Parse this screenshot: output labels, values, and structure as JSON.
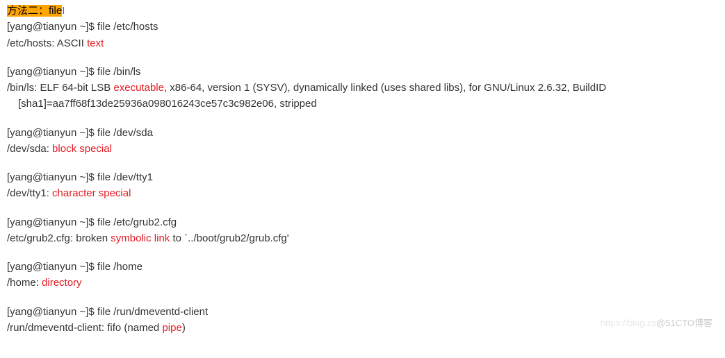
{
  "header": {
    "highlight": "方法二：file",
    "cursor": "I"
  },
  "blocks": [
    {
      "cmd_prefix": "[yang@tianyun ~]$ ",
      "cmd": "file /etc/hosts",
      "out_before": "/etc/hosts: ASCII ",
      "out_red": "text",
      "out_after": ""
    },
    {
      "cmd_prefix": "[yang@tianyun ~]$ ",
      "cmd": "file /bin/ls",
      "out_before": "/bin/ls: ELF 64-bit LSB ",
      "out_red": "executable",
      "out_after": ", x86-64, version 1 (SYSV), dynamically linked (uses shared libs), for GNU/Linux 2.6.32, BuildID",
      "out_line2": "[sha1]=aa7ff68f13de25936a098016243ce57c3c982e06, stripped"
    },
    {
      "cmd_prefix": "[yang@tianyun ~]$ ",
      "cmd": "file /dev/sda",
      "out_before": "/dev/sda: ",
      "out_red": "block special",
      "out_after": ""
    },
    {
      "cmd_prefix": "[yang@tianyun ~]$ ",
      "cmd": "file /dev/tty1",
      "out_before": "/dev/tty1: ",
      "out_red": "character special",
      "out_after": ""
    },
    {
      "cmd_prefix": "[yang@tianyun ~]$ ",
      "cmd": "file /etc/grub2.cfg",
      "out_before": "/etc/grub2.cfg: broken ",
      "out_red": "symbolic link",
      "out_after": " to `../boot/grub2/grub.cfg'"
    },
    {
      "cmd_prefix": "[yang@tianyun ~]$ ",
      "cmd": "file /home",
      "out_before": "/home: ",
      "out_red": "directory",
      "out_after": ""
    },
    {
      "cmd_prefix": "[yang@tianyun ~]$ ",
      "cmd": "file /run/dmeventd-client",
      "out_before": "/run/dmeventd-client: fifo (named ",
      "out_red": "pipe",
      "out_after": ")"
    }
  ],
  "watermark": {
    "faint": "https://blog.cs",
    "text": "@51CTO博客"
  }
}
